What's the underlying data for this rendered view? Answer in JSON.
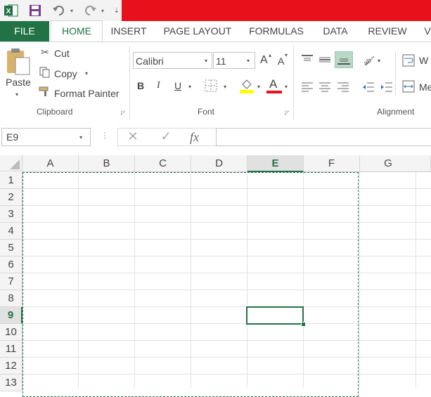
{
  "quick_access": {
    "save_icon": "save-icon",
    "undo_icon": "undo-icon",
    "redo_icon": "redo-icon",
    "customize_icon": "customize-qat-icon"
  },
  "tabs": [
    "FILE",
    "HOME",
    "INSERT",
    "PAGE LAYOUT",
    "FORMULAS",
    "DATA",
    "REVIEW",
    "V"
  ],
  "ribbon": {
    "clipboard": {
      "paste": "Paste",
      "cut": "Cut",
      "copy": "Copy",
      "format_painter": "Format Painter",
      "group_label": "Clipboard"
    },
    "font": {
      "font_name": "Calibri",
      "font_size": "11",
      "grow_label": "A",
      "shrink_label": "A",
      "bold": "B",
      "italic": "I",
      "underline": "U",
      "color_label": "A",
      "group_label": "Font",
      "fill_color": "#ffff00",
      "font_color": "#e8101a"
    },
    "alignment": {
      "group_label": "Alignment",
      "wrap_text_partial": "W",
      "merge_partial": "Me"
    }
  },
  "formula_bar": {
    "name_box": "E9",
    "fx_label": "fx",
    "formula": ""
  },
  "sheet": {
    "columns": [
      "A",
      "B",
      "C",
      "D",
      "E",
      "F",
      "G"
    ],
    "rows": [
      "1",
      "2",
      "3",
      "4",
      "5",
      "6",
      "7",
      "8",
      "9",
      "10",
      "11",
      "12",
      "13"
    ],
    "selected_column": "E",
    "selected_row": "9",
    "accent": "#217346"
  },
  "title_bar_color": "#e8101a"
}
